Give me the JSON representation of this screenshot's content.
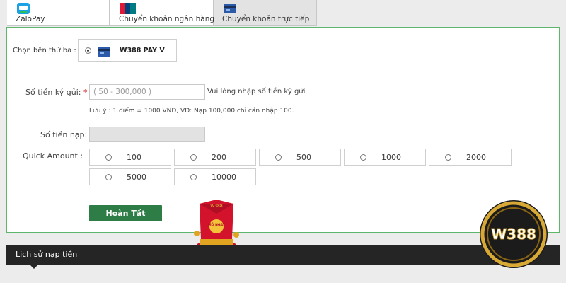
{
  "tabs": [
    {
      "label": "ZaloPay",
      "icon": "zalopay-icon"
    },
    {
      "label": "Chuyển khoản ngân hàng",
      "icon": "unionpay-icon"
    },
    {
      "label": "Chuyển khoản trực tiếp",
      "icon": "wallet-card-icon"
    }
  ],
  "third_party": {
    "label": "Chọn bên thứ ba :",
    "option": "W388 PAY V"
  },
  "deposit": {
    "label": "Số tiền ký gửi:",
    "required_mark": "*",
    "placeholder": "( 50 - 300,000 )",
    "hint": "Vui lòng nhập số tiền ký gửi",
    "note": "Lưu ý : 1 điểm = 1000 VND, VD: Nạp 100,000 chỉ cần nhập 100."
  },
  "topup": {
    "label": "Số tiền nạp:"
  },
  "quick_amount": {
    "label": "Quick Amount :",
    "options": [
      "100",
      "200",
      "500",
      "1000",
      "2000",
      "5000",
      "10000"
    ]
  },
  "submit_label": "Hoàn Tất",
  "promo": {
    "top_text": "W388",
    "center_text": "MỞ NGAY"
  },
  "history_label": "Lịch sử nạp tiền",
  "logo_text": "W388",
  "colors": {
    "accent_border": "#5db66c",
    "button": "#2e7d46",
    "history_bar": "#252525",
    "logo_gold": "#d8a935"
  }
}
